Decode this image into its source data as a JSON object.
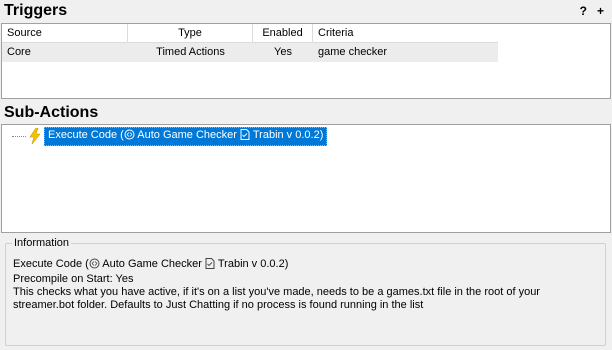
{
  "triggers": {
    "title": "Triggers",
    "help_label": "?",
    "add_label": "+",
    "columns": [
      "Source",
      "Type",
      "Enabled",
      "Criteria"
    ],
    "rows": [
      [
        "Core",
        "Timed Actions",
        "Yes",
        "game checker"
      ]
    ]
  },
  "sub_actions": {
    "title": "Sub-Actions",
    "items": [
      {
        "prefix": "Execute Code (",
        "name": "Auto Game Checker",
        "version": "Trabin v 0.0.2)",
        "icon": "lightning-bolt-icon"
      }
    ]
  },
  "information": {
    "legend": "Information",
    "line1_prefix": "Execute Code (",
    "line1_name": "Auto Game Checker",
    "line1_version": "Trabin v 0.0.2)",
    "line2": "Precompile on Start: Yes",
    "line3": "This checks what you have active, if it's on a list you've made, needs to be a games.txt file in the root of your streamer.bot folder. Defaults to Just Chatting if no process is found running in the list"
  },
  "colors": {
    "selection": "#0078d7",
    "bolt": "#f5c400",
    "row_bg": "#ececec"
  }
}
